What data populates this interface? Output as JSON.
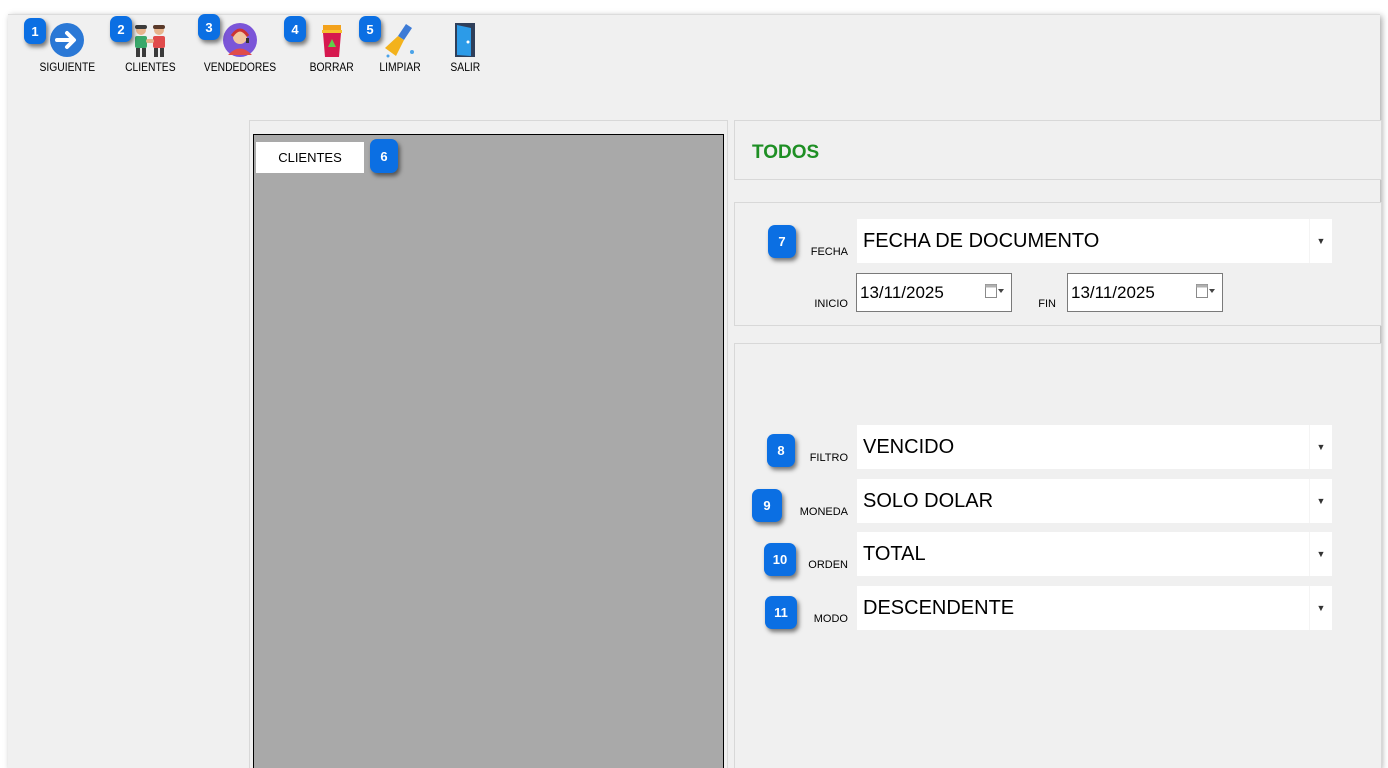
{
  "toolbar": {
    "siguiente": "SIGUIENTE",
    "clientes": "CLIENTES",
    "vendedores": "VENDEDORES",
    "borrar": "BORRAR",
    "limpiar": "LIMPIAR",
    "salir": "SALIR"
  },
  "badges": [
    "1",
    "2",
    "3",
    "4",
    "5",
    "6",
    "7",
    "8",
    "9",
    "10",
    "11"
  ],
  "tab": {
    "label": "CLIENTES"
  },
  "header": {
    "title": "TODOS"
  },
  "fecha": {
    "label": "FECHA",
    "value": "FECHA DE DOCUMENTO"
  },
  "inicio": {
    "label": "INICIO",
    "value": "13/11/2025"
  },
  "fin": {
    "label": "FIN",
    "value": "13/11/2025"
  },
  "filtro": {
    "label": "FILTRO",
    "value": "VENCIDO"
  },
  "moneda": {
    "label": "MONEDA",
    "value": "SOLO DOLAR"
  },
  "orden": {
    "label": "ORDEN",
    "value": "TOTAL"
  },
  "modo": {
    "label": "MODO",
    "value": "DESCENDENTE"
  },
  "icons": {
    "siguiente": "arrow-right-circle-icon",
    "clientes": "clients-handshake-icon",
    "vendedores": "sales-agent-icon",
    "borrar": "trash-bin-icon",
    "limpiar": "broom-icon",
    "salir": "exit-door-icon",
    "calendar": "calendar-icon",
    "dropdown": "dropdown-arrow-icon"
  },
  "colors": {
    "accent_badge": "#0b6fe3",
    "title_green": "#1e8f24",
    "panel_grey": "#a9a9a9",
    "window_bg": "#f0f0f0"
  }
}
